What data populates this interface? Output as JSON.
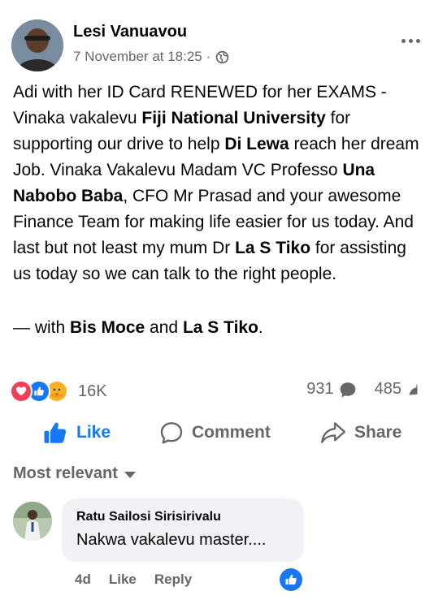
{
  "post": {
    "author": "Lesi Vanuavou",
    "timestamp": "7 November at 18:25 ·",
    "audience_icon": "globe-icon",
    "body": [
      {
        "t": "Adi with her ID Card RENEWED for her EXAMS - Vinaka vakalevu "
      },
      {
        "t": "Fiji National University",
        "b": true
      },
      {
        "t": " for supporting our drive to help "
      },
      {
        "t": "Di Lewa",
        "b": true
      },
      {
        "t": " reach her dream Job. Vinaka Vakalevu Madam VC Professo "
      },
      {
        "t": "Una Nabobo Baba",
        "b": true
      },
      {
        "t": ", CFO Mr Prasad and your awesome Finance Team for making life easier for us today. And last but not least my mum Dr "
      },
      {
        "t": "La S Tiko",
        "b": true
      },
      {
        "t": " for assisting us today so we can talk to the right people."
      }
    ],
    "with_prefix": "— with ",
    "tagged_1": "Bis Moce",
    "with_and": " and ",
    "tagged_2": "La S Tiko",
    "with_suffix": "."
  },
  "stats": {
    "reaction_icons": [
      "love-icon",
      "like-icon",
      "care-icon"
    ],
    "reactions_count": "16K",
    "comments_count": "931",
    "shares_count": "485"
  },
  "actions": {
    "like": "Like",
    "comment": "Comment",
    "share": "Share"
  },
  "sort": {
    "label": "Most relevant"
  },
  "comment": {
    "author": "Ratu Sailosi Sirisirivalu",
    "text": "Nakwa vakalevu master....",
    "age": "4d",
    "like": "Like",
    "reply": "Reply"
  },
  "colors": {
    "brand": "#1877f2",
    "muted": "#65676b",
    "love": "#f33e58",
    "care": "#f7b125",
    "bubble": "#f0f2f5"
  }
}
